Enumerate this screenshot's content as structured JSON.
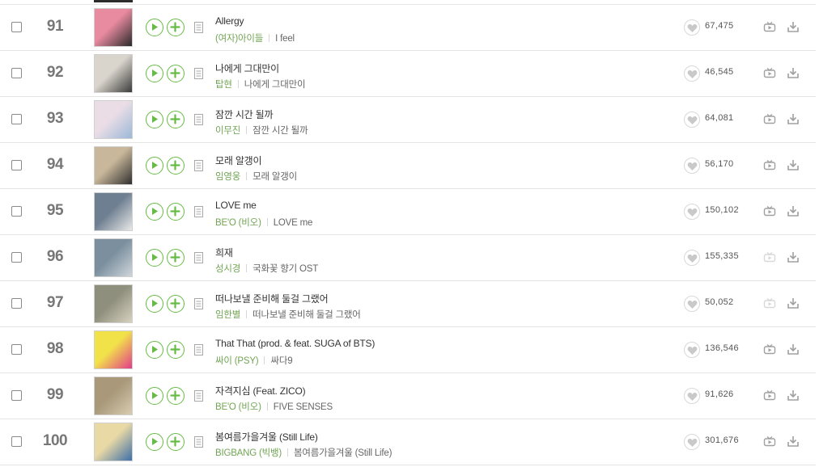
{
  "colors": {
    "accent_green": "#66bb44",
    "artist_green": "#71a554",
    "rank_gray": "#777777",
    "divider": "#e4e4e4"
  },
  "icons": {
    "play": "play-icon",
    "add": "add-icon",
    "lyrics": "lyrics-icon",
    "like": "heart-icon",
    "mv": "mv-icon",
    "download": "download-icon"
  },
  "rows": [
    {
      "rank": "91",
      "title": "Allergy",
      "artist": "(여자)아이들",
      "album": "I feel",
      "likes": "67,475",
      "mv_enabled": true
    },
    {
      "rank": "92",
      "title": "나에게 그대만이",
      "artist": "탑현",
      "album": "나에게 그대만이",
      "likes": "46,545",
      "mv_enabled": true
    },
    {
      "rank": "93",
      "title": "잠깐 시간 될까",
      "artist": "이무진",
      "album": "잠깐 시간 될까",
      "likes": "64,081",
      "mv_enabled": true
    },
    {
      "rank": "94",
      "title": "모래 알갱이",
      "artist": "임영웅",
      "album": "모래 알갱이",
      "likes": "56,170",
      "mv_enabled": true
    },
    {
      "rank": "95",
      "title": "LOVE me",
      "artist": "BE'O (비오)",
      "album": "LOVE me",
      "likes": "150,102",
      "mv_enabled": true
    },
    {
      "rank": "96",
      "title": "희재",
      "artist": "성시경",
      "album": "국화꽃 향기 OST",
      "likes": "155,335",
      "mv_enabled": false
    },
    {
      "rank": "97",
      "title": "떠나보낼 준비해 둘걸 그랬어",
      "artist": "임한별",
      "album": "떠나보낼 준비해 둘걸 그랬어",
      "likes": "50,052",
      "mv_enabled": false
    },
    {
      "rank": "98",
      "title": "That That (prod. & feat. SUGA of BTS)",
      "artist": "싸이 (PSY)",
      "album": "싸다9",
      "likes": "136,546",
      "mv_enabled": true
    },
    {
      "rank": "99",
      "title": "자격지심 (Feat. ZICO)",
      "artist": "BE'O (비오)",
      "album": "FIVE SENSES",
      "likes": "91,626",
      "mv_enabled": true
    },
    {
      "rank": "100",
      "title": "봄여름가을겨울 (Still Life)",
      "artist": "BIGBANG (빅뱅)",
      "album": "봄여름가을겨울 (Still Life)",
      "likes": "301,676",
      "mv_enabled": true
    }
  ]
}
